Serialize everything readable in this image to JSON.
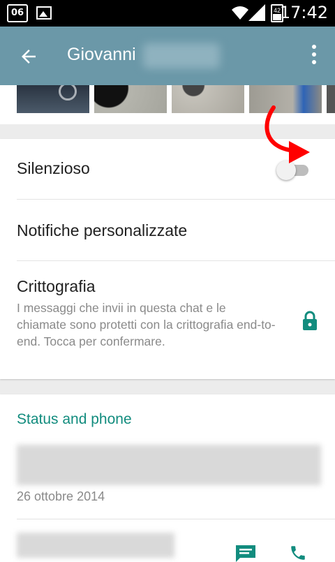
{
  "status_bar": {
    "calendar_day": "06",
    "battery_level": "42",
    "time": "17:42"
  },
  "app_bar": {
    "title": "Giovanni",
    "back_icon": "arrow-back-icon",
    "menu_icon": "more-vert-icon"
  },
  "settings": {
    "silent_label": "Silenzioso",
    "silent_enabled": false,
    "custom_notifications_label": "Notifiche personalizzate",
    "encryption_label": "Crittografia",
    "encryption_description": "I messaggi che invii in questa chat e le chiamate sono protetti con la crittografia end-to-end. Tocca per confermare.",
    "lock_icon": "lock-icon"
  },
  "status_section": {
    "title": "Status and phone",
    "status_date": "26 ottobre 2014",
    "message_icon": "message-icon",
    "call_icon": "call-icon"
  },
  "colors": {
    "app_bar": "#6b98a8",
    "accent": "#128c7e",
    "annotation_arrow": "#ff0000"
  }
}
